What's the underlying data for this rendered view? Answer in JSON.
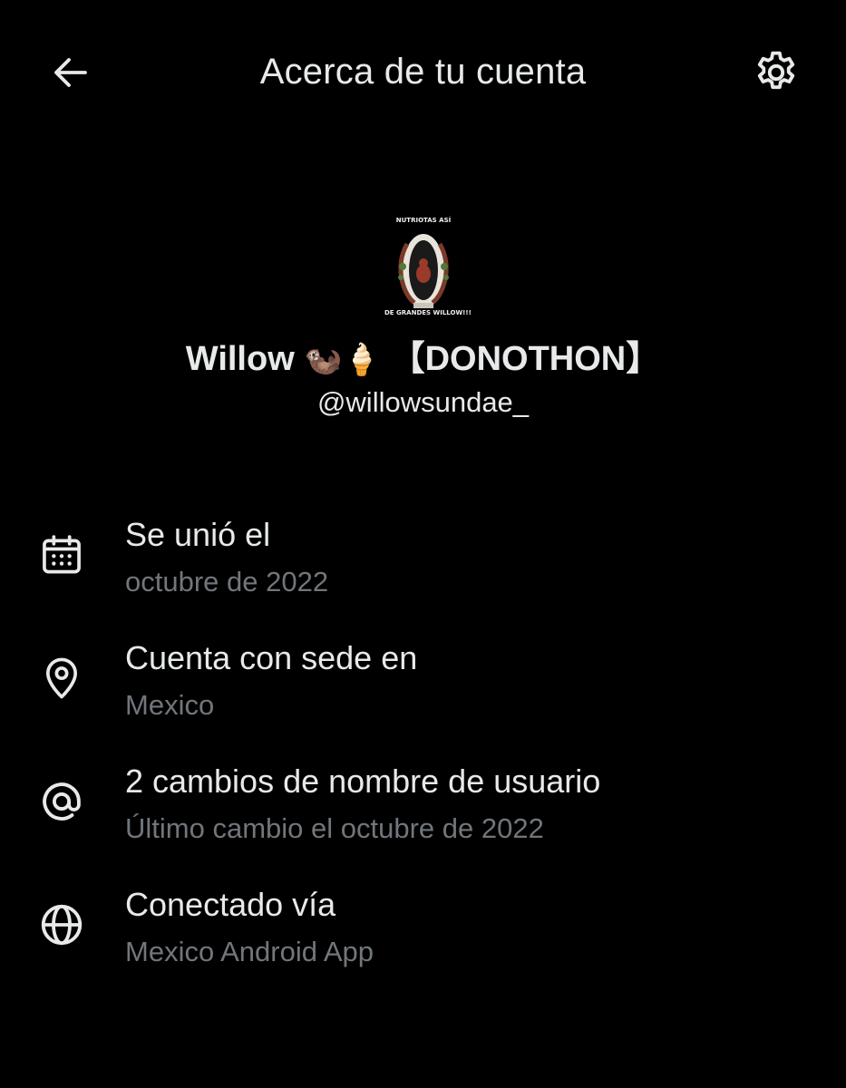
{
  "header": {
    "title": "Acerca de tu cuenta",
    "back_icon": "arrow-left-icon",
    "settings_icon": "gear-icon"
  },
  "profile": {
    "avatar_caption_top": "NUTRIOTAS ASÍ",
    "avatar_caption_bottom": "DE GRANDES WILLOW!!!",
    "display_name": "Willow",
    "display_name_emoji": "🦦🍦",
    "display_name_suffix": "【DONOTHON】",
    "handle": "@willowsundae_"
  },
  "info": [
    {
      "icon": "calendar-icon",
      "label": "Se unió el",
      "value": "octubre de 2022"
    },
    {
      "icon": "location-pin-icon",
      "label": "Cuenta con sede en",
      "value": "Mexico"
    },
    {
      "icon": "at-sign-icon",
      "label": "2 cambios de nombre de usuario",
      "value": "Último cambio el octubre de 2022"
    },
    {
      "icon": "globe-icon",
      "label": "Conectado vía",
      "value": "Mexico Android App"
    }
  ],
  "colors": {
    "background": "#000000",
    "primary_text": "#e7e9ea",
    "secondary_text": "#71767b"
  }
}
